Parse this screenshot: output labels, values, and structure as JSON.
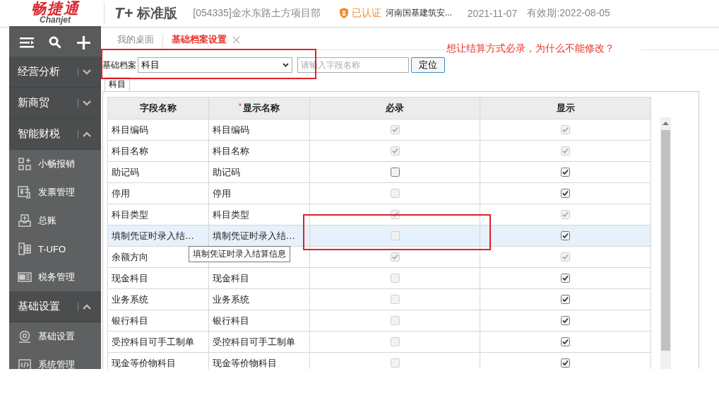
{
  "header": {
    "logo_text": "畅捷通",
    "logo_subtext": "Chanjet",
    "product_mark": "T+",
    "product_name": "标准版",
    "account": "[054335]金水东路土方项目部",
    "verified": "已认证",
    "company": "河南国基建筑安...",
    "date": "2021-11-07",
    "expiry": "有效期:2022-08-05"
  },
  "sidebar": {
    "sections": [
      {
        "label": "经营分析",
        "expanded": false
      },
      {
        "label": "新商贸",
        "expanded": false
      },
      {
        "label": "智能财税",
        "expanded": true,
        "items": [
          {
            "kind": "apps",
            "label": "小畅报销"
          },
          {
            "kind": "invoice",
            "label": "发票管理"
          },
          {
            "kind": "ledger",
            "label": "总账"
          },
          {
            "kind": "report",
            "label": "T-UFO"
          },
          {
            "kind": "tax",
            "label": "税务管理"
          }
        ]
      },
      {
        "label": "基础设置",
        "expanded": true,
        "items": [
          {
            "kind": "settings",
            "label": "基础设置"
          },
          {
            "kind": "code",
            "label": "系统管理"
          }
        ]
      }
    ]
  },
  "tabs": [
    {
      "label": "我的桌面",
      "selected": false,
      "closable": false
    },
    {
      "label": "基础档案设置",
      "selected": true,
      "closable": true
    }
  ],
  "note": "想让结算方式必录，为什么不能修改？",
  "toolbar": {
    "label": "基础档案",
    "select_value": "科目",
    "highlighted": true,
    "search_placeholder": "请输入字段名称",
    "locate_button": "定位"
  },
  "sub_tabs": [
    {
      "label": "科目",
      "selected": true
    }
  ],
  "table": {
    "columns": [
      {
        "label": "字段名称"
      },
      {
        "label": "显示名称",
        "marker": "*"
      },
      {
        "label": "必录"
      },
      {
        "label": "显示"
      }
    ],
    "rows": [
      {
        "field": "科目编码",
        "display_name": "科目编码",
        "selected": false,
        "required": {
          "checked": true,
          "disabled": true
        },
        "display": {
          "checked": true,
          "disabled": true
        }
      },
      {
        "field": "科目名称",
        "display_name": "科目名称",
        "selected": false,
        "required": {
          "checked": true,
          "disabled": true
        },
        "display": {
          "checked": true,
          "disabled": true
        }
      },
      {
        "field": "助记码",
        "display_name": "助记码",
        "selected": false,
        "required": {
          "checked": false,
          "disabled": false
        },
        "display": {
          "checked": true,
          "disabled": false
        }
      },
      {
        "field": "停用",
        "display_name": "停用",
        "selected": false,
        "required": {
          "checked": false,
          "disabled": true
        },
        "display": {
          "checked": true,
          "disabled": false
        }
      },
      {
        "field": "科目类型",
        "display_name": "科目类型",
        "selected": false,
        "required": {
          "checked": true,
          "disabled": true
        },
        "display": {
          "checked": true,
          "disabled": true
        }
      },
      {
        "field": "填制凭证时录入结…",
        "display_name": "填制凭证时录入结…",
        "selected": true,
        "tooltip": "填制凭证时录入结算信息",
        "required": {
          "checked": false,
          "disabled": true,
          "highlighted": true
        },
        "display": {
          "checked": true,
          "disabled": false
        }
      },
      {
        "field": "余额方向",
        "selected": false,
        "required": {
          "checked": true,
          "disabled": true
        },
        "display": {
          "checked": true,
          "disabled": true
        }
      },
      {
        "field": "现金科目",
        "display_name": "现金科目",
        "selected": false,
        "required": {
          "checked": false,
          "disabled": true
        },
        "display": {
          "checked": true,
          "disabled": false
        }
      },
      {
        "field": "业务系统",
        "display_name": "业务系统",
        "selected": false,
        "required": {
          "checked": false,
          "disabled": true
        },
        "display": {
          "checked": true,
          "disabled": false
        }
      },
      {
        "field": "银行科目",
        "display_name": "银行科目",
        "selected": false,
        "required": {
          "checked": false,
          "disabled": true
        },
        "display": {
          "checked": true,
          "disabled": false
        }
      },
      {
        "field": "受控科目可手工制单",
        "display_name": "受控科目可手工制单",
        "selected": false,
        "required": {
          "checked": false,
          "disabled": true
        },
        "display": {
          "checked": true,
          "disabled": false
        }
      },
      {
        "field": "现金等价物科目",
        "display_name": "现金等价物科目",
        "selected": false,
        "required": {
          "checked": false,
          "disabled": true
        },
        "display": {
          "checked": true,
          "disabled": false
        }
      }
    ]
  }
}
